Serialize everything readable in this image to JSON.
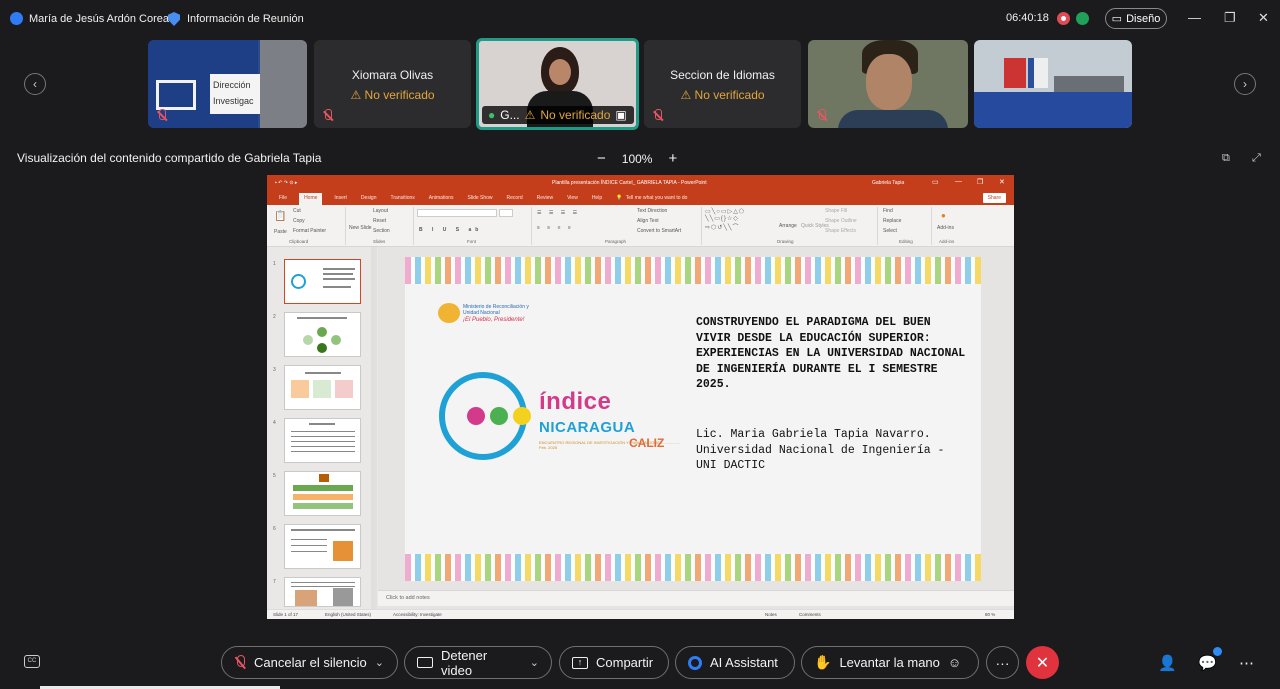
{
  "topbar": {
    "host_name": "María de Jesús Ardón Corea",
    "meeting_info": "Información de Reunión",
    "timer": "06:40:18",
    "layout_button": "Diseño"
  },
  "participants": [
    {
      "name": "",
      "status": "",
      "kind": "banner",
      "banner_text": "Dirección Investigac"
    },
    {
      "name": "Xiomara Olivas",
      "status": "No verificado"
    },
    {
      "name": "G...",
      "status": "No verificado",
      "active": true
    },
    {
      "name": "Seccion de Idiomas",
      "status": "No verificado"
    },
    {
      "name": "",
      "status": "",
      "kind": "video-man"
    },
    {
      "name": "",
      "status": "",
      "kind": "video-room"
    }
  ],
  "share": {
    "title": "Visualización del contenido compartido de Gabriela Tapia",
    "zoom": "100%",
    "zoom_minus": "−",
    "zoom_plus": "+"
  },
  "powerpoint": {
    "doc_title": "Plantilla presentación ÍNDICE Cartel_ GABRIELA TAPIA  -  PowerPoint",
    "user": "Gabriela Tapia",
    "tabs": [
      "File",
      "Home",
      "Insert",
      "Design",
      "Transitions",
      "Animations",
      "Slide Show",
      "Record",
      "Review",
      "View",
      "Help"
    ],
    "tell_me": "Tell me what you want to do",
    "share_label": "Share",
    "ribbon_groups": [
      "Clipboard",
      "Slides",
      "Font",
      "Paragraph",
      "Drawing",
      "Editing",
      "Add-ins"
    ],
    "ribbon_items": {
      "paste": "Paste",
      "cut": "Cut",
      "copy": "Copy",
      "format_painter": "Format Painter",
      "new_slide": "New Slide",
      "layout": "Layout",
      "reset": "Reset",
      "section": "Section",
      "text_direction": "Text Direction",
      "align_text": "Align Text",
      "smartart": "Convert to SmartArt",
      "arrange": "Arrange",
      "quick_styles": "Quick Styles",
      "shape_fill": "Shape Fill",
      "shape_outline": "Shape Outline",
      "shape_effects": "Shape Effects",
      "find": "Find",
      "replace": "Replace",
      "select": "Select",
      "addins": "Add-ins"
    },
    "slide_numbers": [
      "1",
      "2",
      "3",
      "4",
      "5",
      "6",
      "7"
    ],
    "slide": {
      "title": "CONSTRUYENDO EL PARADIGMA DEL BUEN VIVIR DESDE LA EDUCACIÓN SUPERIOR: EXPERIENCIAS EN LA UNIVERSIDAD NACIONAL DE INGENIERÍA DURANTE EL I SEMESTRE 2025.",
      "author": "Lic. Maria Gabriela Tapia Navarro.",
      "institution": "Universidad Nacional de Ingeniería - UNI DACTIC",
      "logo_word1": "índice",
      "logo_word2": "NICARAGUA",
      "logo_sub": "ENCUENTRO REGIONAL DE INVESTIGACIÓN Y PUBLICACIONES ............... Feb. 2025",
      "caliz": "CALIZ",
      "ministry": "Ministerio de Reconciliación y Unidad Nacional",
      "ministry_slogan": "¡El Pueblo, Presidente!"
    },
    "notes_placeholder": "Click to add notes",
    "status": {
      "slide_of": "Slide 1 of 17",
      "language": "English (United States)",
      "accessibility": "Accessibility: Investigate",
      "notes": "Notes",
      "comments": "Comments",
      "zoom": "80 %"
    }
  },
  "controls": {
    "mute": "Cancelar el silencio",
    "video": "Detener video",
    "share": "Compartir",
    "ai": "AI Assistant",
    "raise_hand": "Levantar la mano",
    "more": "···",
    "end": "✕"
  },
  "colors": {
    "accent_end": "#e0333d",
    "warning": "#e2a63b",
    "active_border": "#1f9c88",
    "ppt_red": "#c43e1c"
  }
}
